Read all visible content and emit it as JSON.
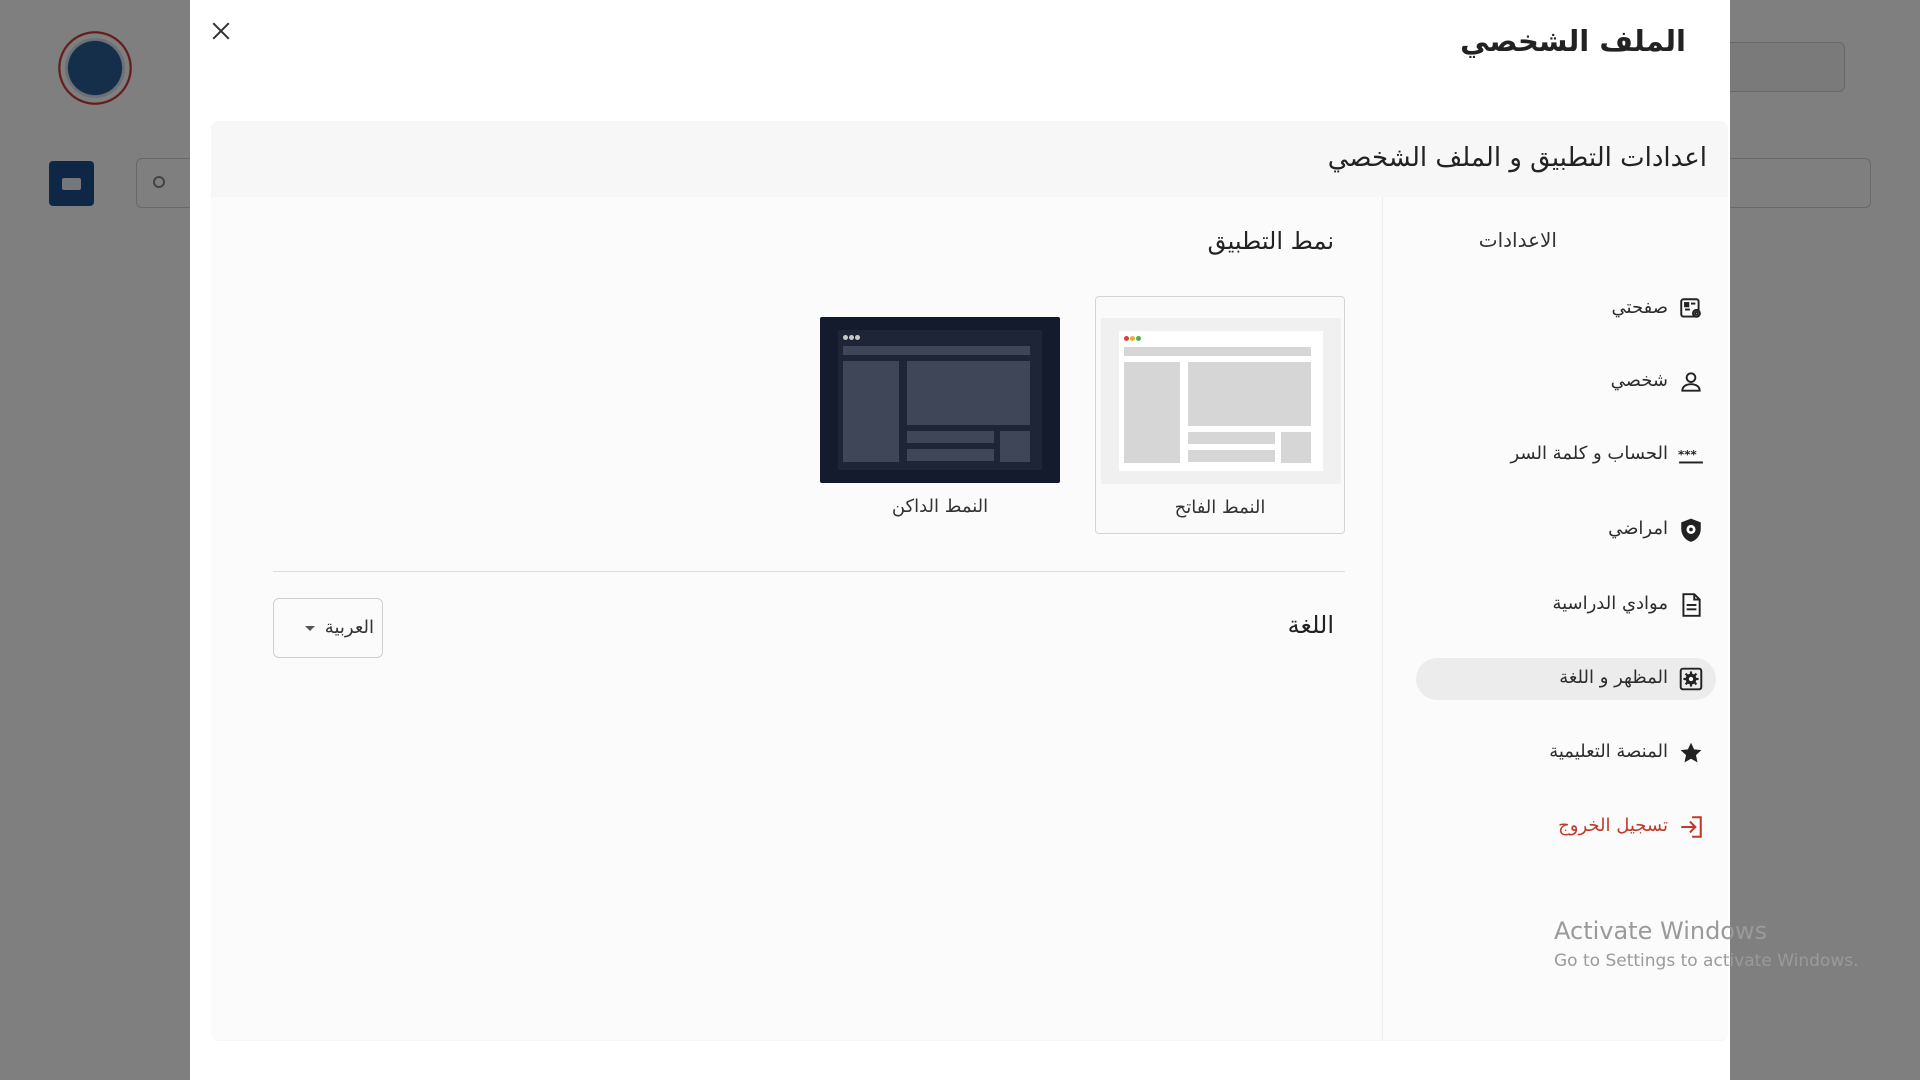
{
  "modal": {
    "title": "الملف الشخصي",
    "panel_title": "اعدادات التطبيق و الملف الشخصي"
  },
  "sidebar": {
    "heading": "الاعدادات",
    "items": [
      {
        "label": "صفحتي",
        "icon": "profile-card-icon",
        "active": false
      },
      {
        "label": "شخصي",
        "icon": "user-icon",
        "active": false
      },
      {
        "label": "الحساب و كلمة السر",
        "icon": "password-asterisks-icon",
        "active": false
      },
      {
        "label": "امراضي",
        "icon": "shield-icon",
        "active": false
      },
      {
        "label": "موادي الدراسية",
        "icon": "document-icon",
        "active": false
      },
      {
        "label": "المظهر و اللغة",
        "icon": "gear-square-icon",
        "active": true
      },
      {
        "label": "المنصة التعليمية",
        "icon": "star-icon",
        "active": false
      },
      {
        "label": "تسجيل الخروج",
        "icon": "logout-icon",
        "active": false
      }
    ]
  },
  "theme_section": {
    "title": "نمط التطبيق",
    "light_label": "النمط الفاتح",
    "dark_label": "النمط الداكن",
    "selected": "light"
  },
  "language_section": {
    "title": "اللغة",
    "selected": "العربية"
  },
  "watermark": {
    "line1": "Activate Windows",
    "line2": "Go to Settings to activate Windows."
  },
  "colors": {
    "logout": "#c0392b",
    "dark_theme_bg": "#141b2d",
    "active_item_bg": "#ececec"
  }
}
